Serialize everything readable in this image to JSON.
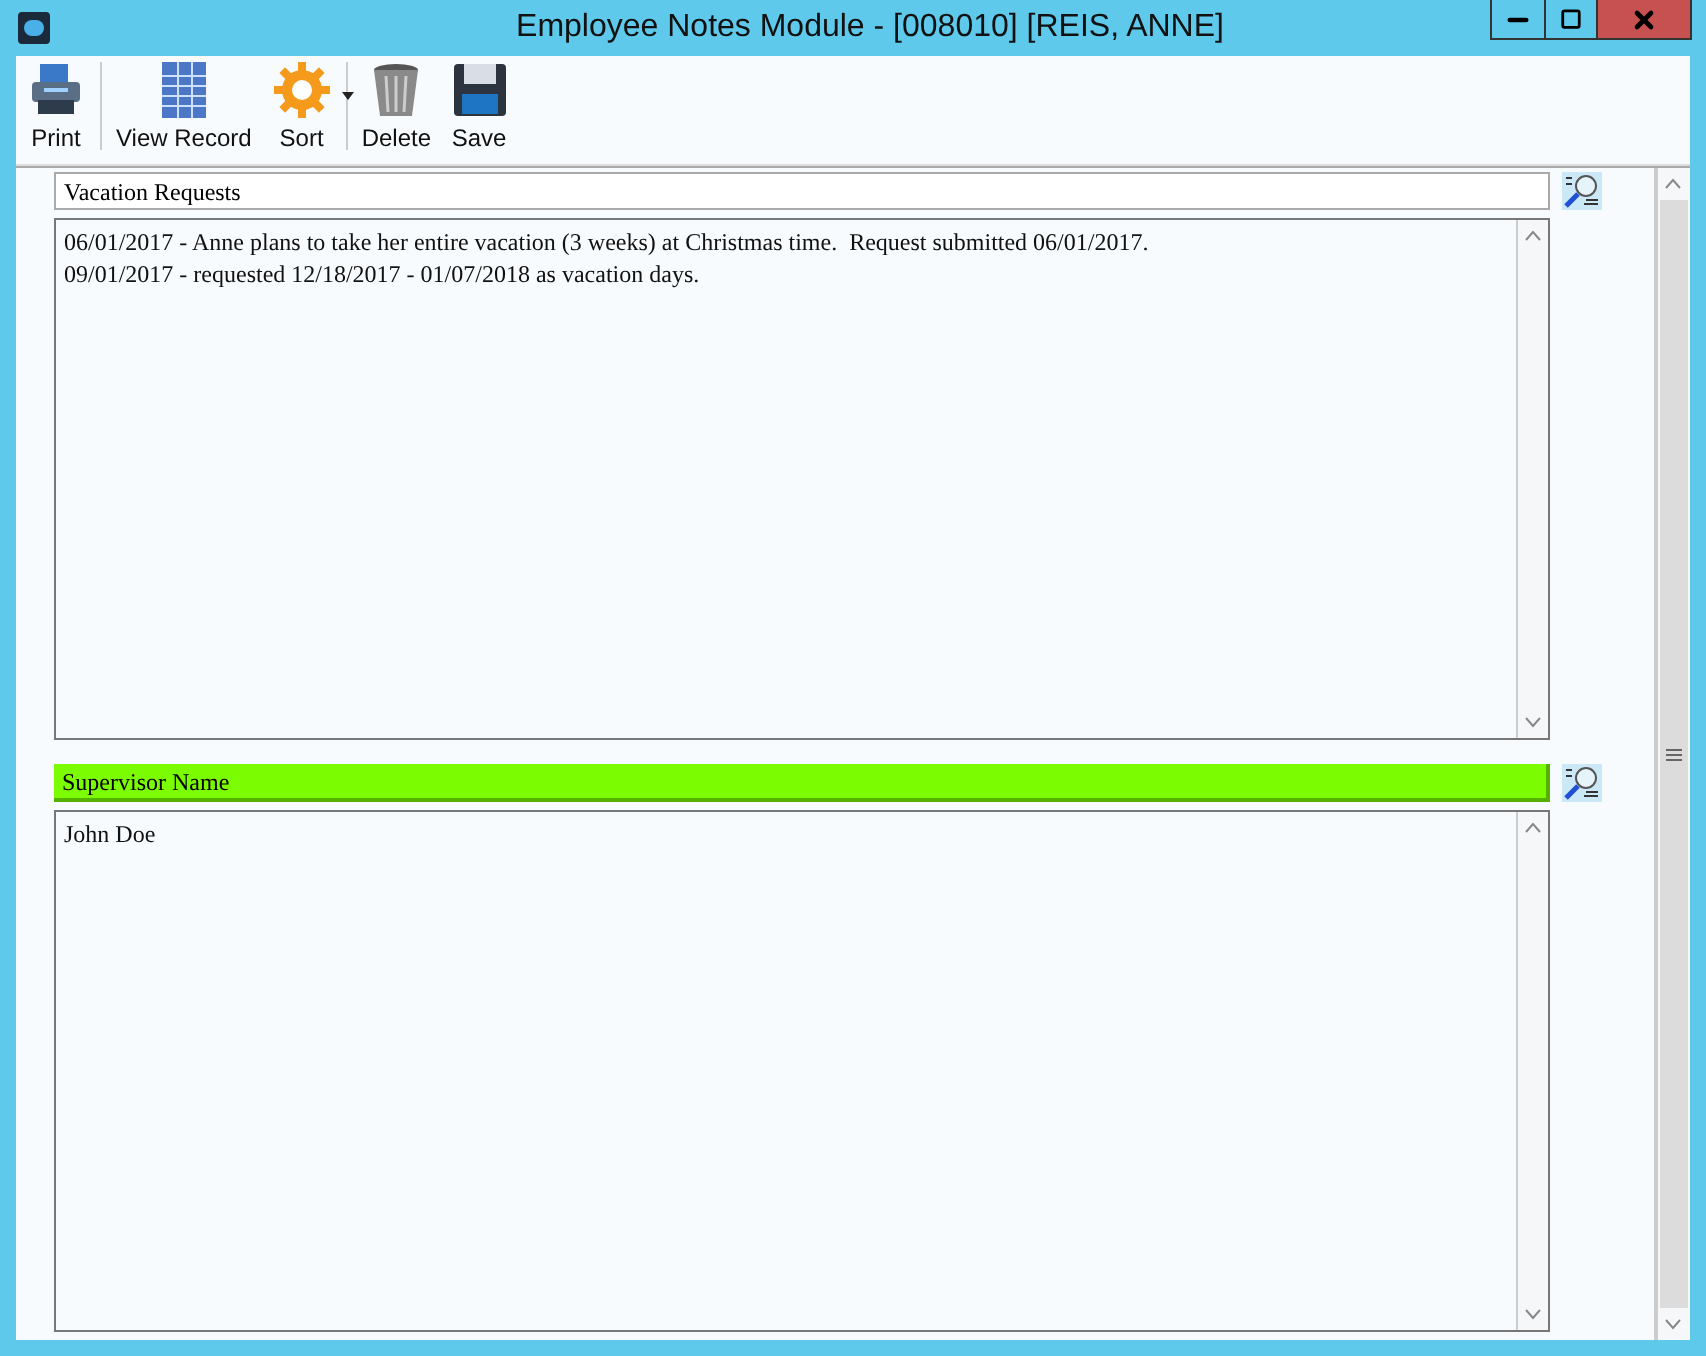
{
  "window": {
    "title": "Employee Notes Module - [008010] [REIS, ANNE]"
  },
  "toolbar": [
    {
      "kind": "print",
      "label": "Print"
    },
    {
      "kind": "view",
      "label": "View Record"
    },
    {
      "kind": "sort",
      "label": "Sort"
    },
    {
      "kind": "delete",
      "label": "Delete"
    },
    {
      "kind": "save",
      "label": "Save"
    }
  ],
  "sections": [
    {
      "label": "Vacation Requests",
      "highlighted": false,
      "lines": [
        "06/01/2017 - Anne plans to take her entire vacation (3 weeks) at Christmas time.  Request submitted 06/01/2017.",
        "09/01/2017 - requested 12/18/2017 - 01/07/2018 as vacation days."
      ]
    },
    {
      "label": "Supervisor Name",
      "highlighted": true,
      "lines": [
        "John Doe"
      ]
    }
  ]
}
